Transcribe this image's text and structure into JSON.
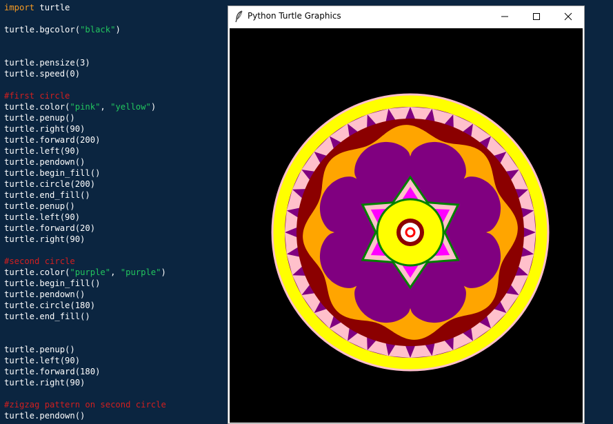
{
  "window": {
    "title": "Python Turtle Graphics",
    "icon": "feather-icon",
    "controls": [
      "minimize-icon",
      "maximize-icon",
      "close-icon"
    ]
  },
  "canvas": {
    "background": "black"
  },
  "code_lines": [
    {
      "tokens": [
        {
          "t": "import",
          "c": "kw"
        },
        {
          "t": " turtle",
          "c": "plain"
        }
      ]
    },
    {
      "tokens": []
    },
    {
      "tokens": [
        {
          "t": "turtle.bgcolor(",
          "c": "plain"
        },
        {
          "t": "\"black\"",
          "c": "str"
        },
        {
          "t": ")",
          "c": "plain"
        }
      ]
    },
    {
      "tokens": []
    },
    {
      "tokens": []
    },
    {
      "tokens": [
        {
          "t": "turtle.pensize(3)",
          "c": "plain"
        }
      ]
    },
    {
      "tokens": [
        {
          "t": "turtle.speed(0)",
          "c": "plain"
        }
      ]
    },
    {
      "tokens": []
    },
    {
      "tokens": [
        {
          "t": "#first circle",
          "c": "comment"
        }
      ]
    },
    {
      "tokens": [
        {
          "t": "turtle.color(",
          "c": "plain"
        },
        {
          "t": "\"pink\"",
          "c": "str"
        },
        {
          "t": ", ",
          "c": "plain"
        },
        {
          "t": "\"yellow\"",
          "c": "str"
        },
        {
          "t": ")",
          "c": "plain"
        }
      ]
    },
    {
      "tokens": [
        {
          "t": "turtle.penup()",
          "c": "plain"
        }
      ]
    },
    {
      "tokens": [
        {
          "t": "turtle.right(90)",
          "c": "plain"
        }
      ]
    },
    {
      "tokens": [
        {
          "t": "turtle.forward(200)",
          "c": "plain"
        }
      ]
    },
    {
      "tokens": [
        {
          "t": "turtle.left(90)",
          "c": "plain"
        }
      ]
    },
    {
      "tokens": [
        {
          "t": "turtle.pendown()",
          "c": "plain"
        }
      ]
    },
    {
      "tokens": [
        {
          "t": "turtle.begin_fill()",
          "c": "plain"
        }
      ]
    },
    {
      "tokens": [
        {
          "t": "turtle.circle(200)",
          "c": "plain"
        }
      ]
    },
    {
      "tokens": [
        {
          "t": "turtle.end_fill()",
          "c": "plain"
        }
      ]
    },
    {
      "tokens": [
        {
          "t": "turtle.penup()",
          "c": "plain"
        }
      ]
    },
    {
      "tokens": [
        {
          "t": "turtle.left(90)",
          "c": "plain"
        }
      ]
    },
    {
      "tokens": [
        {
          "t": "turtle.forward(20)",
          "c": "plain"
        }
      ]
    },
    {
      "tokens": [
        {
          "t": "turtle.right(90)",
          "c": "plain"
        }
      ]
    },
    {
      "tokens": []
    },
    {
      "tokens": [
        {
          "t": "#second circle",
          "c": "comment"
        }
      ]
    },
    {
      "tokens": [
        {
          "t": "turtle.color(",
          "c": "plain"
        },
        {
          "t": "\"purple\"",
          "c": "str"
        },
        {
          "t": ", ",
          "c": "plain"
        },
        {
          "t": "\"purple\"",
          "c": "str"
        },
        {
          "t": ")",
          "c": "plain"
        }
      ]
    },
    {
      "tokens": [
        {
          "t": "turtle.begin_fill()",
          "c": "plain"
        }
      ]
    },
    {
      "tokens": [
        {
          "t": "turtle.pendown()",
          "c": "plain"
        }
      ]
    },
    {
      "tokens": [
        {
          "t": "turtle.circle(180)",
          "c": "plain"
        }
      ]
    },
    {
      "tokens": [
        {
          "t": "turtle.end_fill()",
          "c": "plain"
        }
      ]
    },
    {
      "tokens": []
    },
    {
      "tokens": []
    },
    {
      "tokens": [
        {
          "t": "turtle.penup()",
          "c": "plain"
        }
      ]
    },
    {
      "tokens": [
        {
          "t": "turtle.left(90)",
          "c": "plain"
        }
      ]
    },
    {
      "tokens": [
        {
          "t": "turtle.forward(180)",
          "c": "plain"
        }
      ]
    },
    {
      "tokens": [
        {
          "t": "turtle.right(90)",
          "c": "plain"
        }
      ]
    },
    {
      "tokens": []
    },
    {
      "tokens": [
        {
          "t": "#zigzag pattern on second circle",
          "c": "comment"
        }
      ]
    },
    {
      "tokens": [
        {
          "t": "turtle.pendown()",
          "c": "plain"
        }
      ]
    }
  ],
  "colors": {
    "editor_bg": "#0b2540",
    "keyword": "#f59a23",
    "string": "#22c55e",
    "comment": "#d21f1f",
    "pink": "#ffc0cb",
    "yellow": "#ffff00",
    "purple": "#800080",
    "darkred": "#8b0000",
    "orange": "#ffa500",
    "magenta": "#ff00ff",
    "green": "#008000",
    "red": "#ff0000",
    "white": "#ffffff"
  }
}
